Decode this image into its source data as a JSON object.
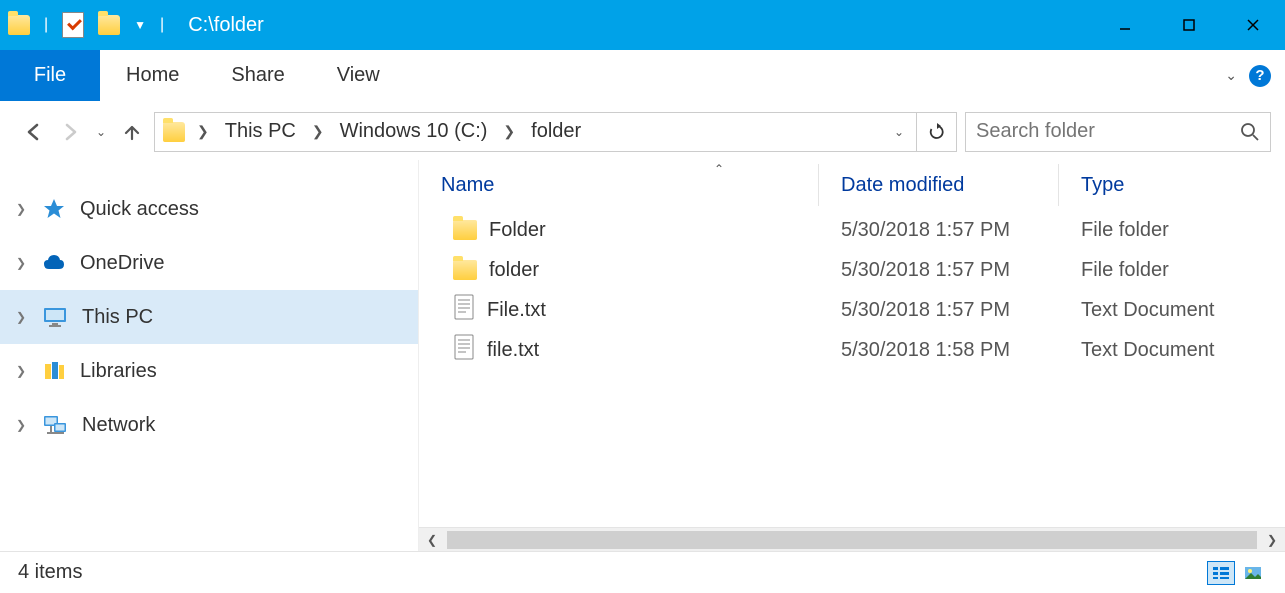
{
  "window": {
    "title": "C:\\folder"
  },
  "ribbon": {
    "file": "File",
    "tabs": [
      "Home",
      "Share",
      "View"
    ]
  },
  "breadcrumb": {
    "segments": [
      "This PC",
      "Windows 10 (C:)",
      "folder"
    ]
  },
  "search": {
    "placeholder": "Search folder"
  },
  "sidebar": {
    "items": [
      {
        "label": "Quick access",
        "icon": "star"
      },
      {
        "label": "OneDrive",
        "icon": "cloud"
      },
      {
        "label": "This PC",
        "icon": "monitor",
        "selected": true
      },
      {
        "label": "Libraries",
        "icon": "libraries"
      },
      {
        "label": "Network",
        "icon": "network"
      }
    ]
  },
  "columns": {
    "name": "Name",
    "date": "Date modified",
    "type": "Type"
  },
  "files": [
    {
      "name": "Folder",
      "date": "5/30/2018 1:57 PM",
      "type": "File folder",
      "kind": "folder"
    },
    {
      "name": "folder",
      "date": "5/30/2018 1:57 PM",
      "type": "File folder",
      "kind": "folder"
    },
    {
      "name": "File.txt",
      "date": "5/30/2018 1:57 PM",
      "type": "Text Document",
      "kind": "text"
    },
    {
      "name": "file.txt",
      "date": "5/30/2018 1:58 PM",
      "type": "Text Document",
      "kind": "text"
    }
  ],
  "status": {
    "count": "4 items"
  }
}
